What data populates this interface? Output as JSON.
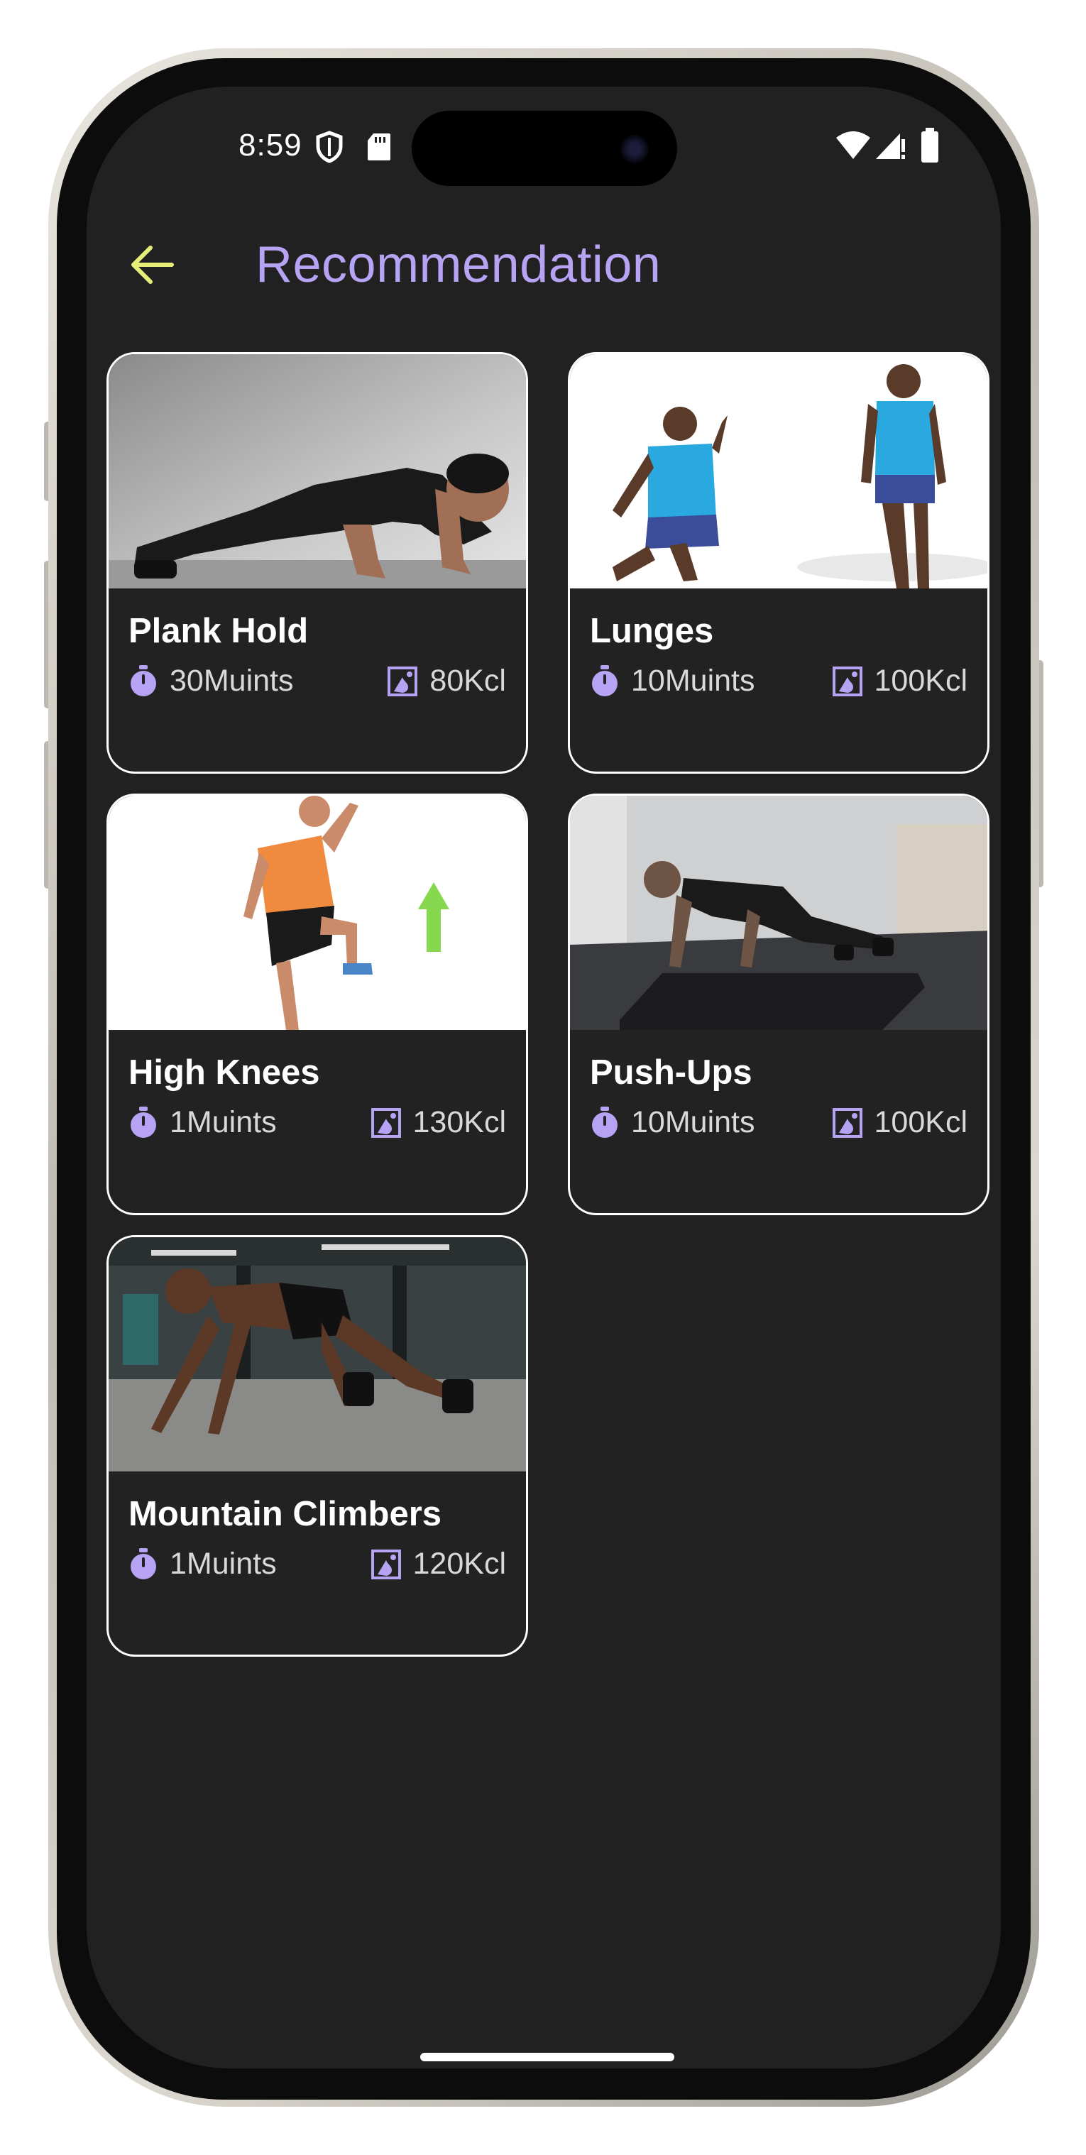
{
  "status_bar": {
    "time": "8:59"
  },
  "header": {
    "title": "Recommendation",
    "back_icon": "arrow-left-icon"
  },
  "colors": {
    "accent": "#b7a3f3",
    "back_arrow": "#e7ee77",
    "background": "#212121",
    "card_border": "#ffffff"
  },
  "cards": [
    {
      "name": "Plank Hold",
      "time": "30Muints",
      "kcal": "80Kcl"
    },
    {
      "name": "Lunges",
      "time": "10Muints",
      "kcal": "100Kcl"
    },
    {
      "name": "High Knees",
      "time": "1Muints",
      "kcal": "130Kcl"
    },
    {
      "name": "Push-Ups",
      "time": "10Muints",
      "kcal": "100Kcl"
    },
    {
      "name": "Mountain Climbers",
      "time": "1Muints",
      "kcal": "120Kcl"
    }
  ]
}
